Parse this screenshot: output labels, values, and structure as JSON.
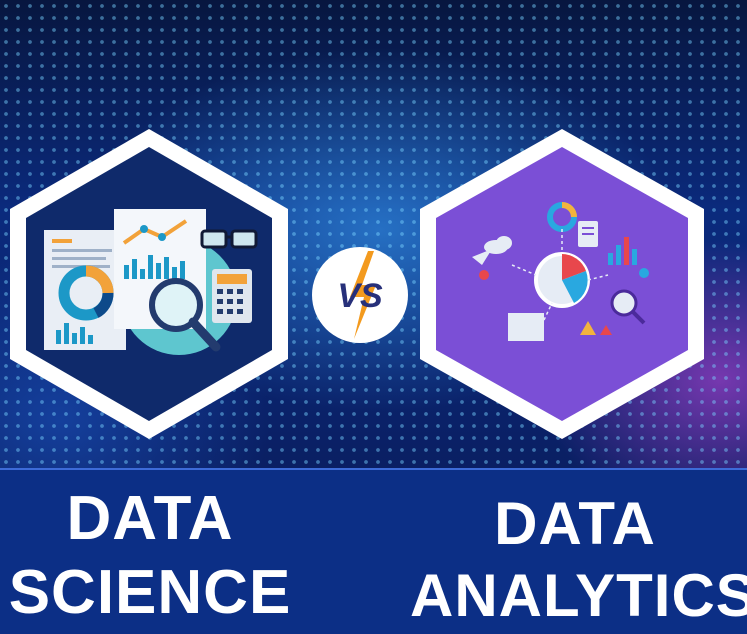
{
  "left": {
    "line1": "DATA",
    "line2": "SCIENCE"
  },
  "right": {
    "line1": "DATA",
    "line2": "ANALYTICS"
  },
  "vs_text": "VS",
  "colors": {
    "left_hex_fill": "#0f2a6b",
    "right_hex_fill": "#7b4fd6",
    "hex_border": "#ffffff",
    "band": "#0c2f86",
    "vs_accent": "#f39a1e",
    "vs_text": "#27307a"
  },
  "icons": {
    "left": [
      "document-icon",
      "line-chart-icon",
      "donut-chart-icon",
      "magnifier-icon",
      "glasses-icon",
      "calculator-icon",
      "bar-chart-icon"
    ],
    "right": [
      "donut-chart-icon",
      "pie-chart-icon",
      "bar-chart-icon",
      "map-pin-icon",
      "cloud-icon",
      "clipboard-icon",
      "magnifier-icon",
      "paper-plane-icon"
    ]
  }
}
